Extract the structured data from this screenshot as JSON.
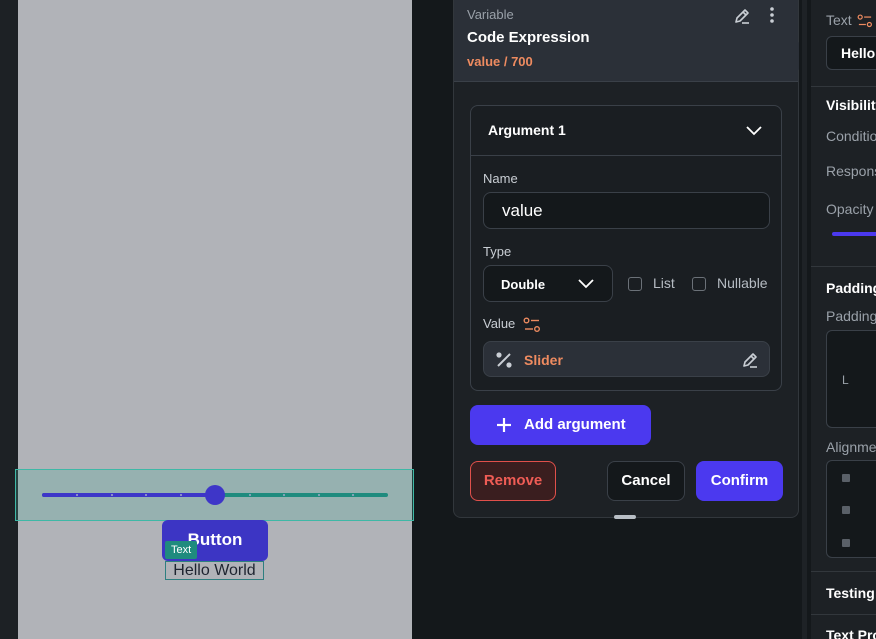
{
  "canvas": {
    "button_label": "Button",
    "text_tag": "Text",
    "hello_text": "Hello World",
    "slider": {
      "value_fraction": 0.5
    }
  },
  "popover": {
    "header": {
      "kind": "Variable",
      "title": "Code Expression",
      "subtitle": "value / 700"
    },
    "argument": {
      "title": "Argument 1",
      "name_label": "Name",
      "name_value": "value",
      "type_label": "Type",
      "type_value": "Double",
      "list_label": "List",
      "nullable_label": "Nullable",
      "value_label": "Value",
      "value_source": "Slider"
    },
    "add_argument_label": "Add argument",
    "remove_label": "Remove",
    "cancel_label": "Cancel",
    "confirm_label": "Confirm"
  },
  "right_panel": {
    "text_label": "Text",
    "text_value": "Hello",
    "visibility": "Visibility",
    "condition": "Condition",
    "responsive": "Responsive",
    "opacity": "Opacity",
    "padding_header": "Padding",
    "padding": "Padding",
    "padding_left": "L",
    "alignment": "Alignment",
    "testing": "Testing",
    "text_props": "Text Pro"
  },
  "colors": {
    "accent": "#4b39ef",
    "orange": "#ee8b60",
    "danger": "#ef5c55",
    "selection": "#3fb8a6"
  }
}
